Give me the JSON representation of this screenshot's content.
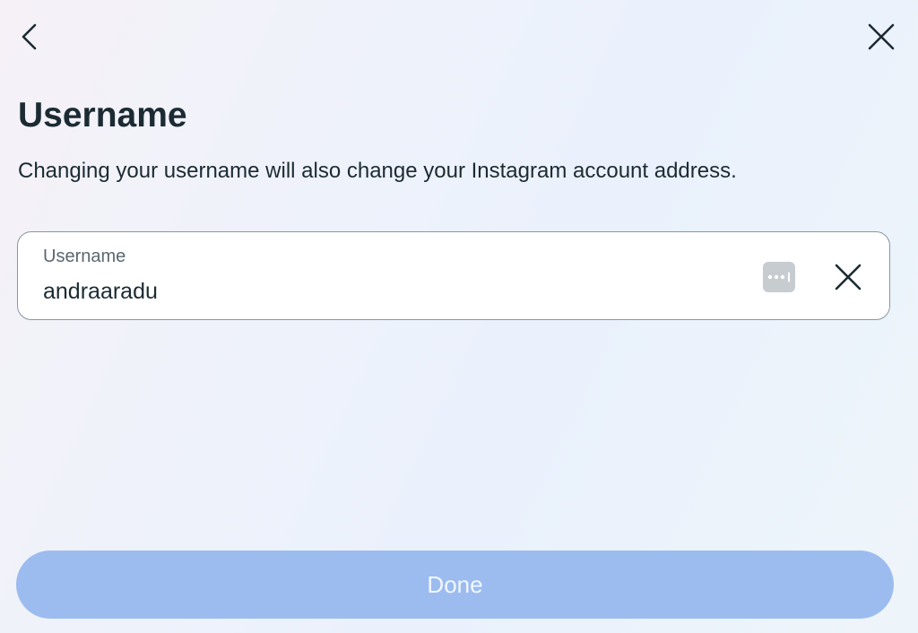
{
  "header": {
    "back_icon": "chevron-left-icon",
    "close_icon": "close-icon"
  },
  "page": {
    "title": "Username",
    "description": "Changing your username will also change your Instagram account address."
  },
  "username_field": {
    "label": "Username",
    "value": "andraaradu",
    "autofill_icon": "password-autofill-icon",
    "clear_icon": "clear-icon"
  },
  "footer": {
    "done_label": "Done",
    "done_enabled": false
  },
  "colors": {
    "text_primary": "#1c2b33",
    "text_secondary": "#5b6770",
    "field_border": "#8a96a0",
    "button_disabled_bg": "#9cbcf0",
    "button_disabled_text": "#f3f7ff",
    "autofill_icon_bg": "#c7ccd1"
  }
}
